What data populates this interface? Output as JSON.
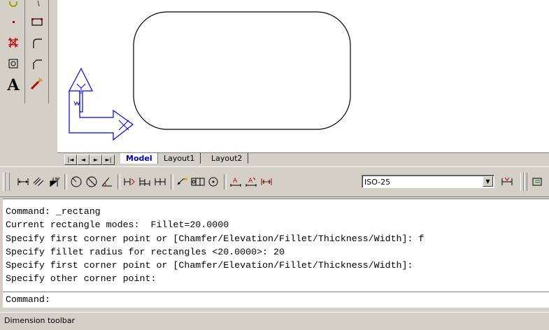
{
  "left_toolbars": {
    "col1": [
      "point-icon",
      "hatch-icon",
      "region-icon",
      "text-icon"
    ],
    "col2": [
      "rectangle-icon",
      "fillet-icon",
      "chamfer-icon",
      "explode-icon"
    ]
  },
  "layout_tabs": {
    "nav": [
      "|◄",
      "◄",
      "►",
      "►|"
    ],
    "tabs": [
      "Model",
      "Layout1",
      "Layout2"
    ],
    "active": "Model"
  },
  "dimension_toolbar": {
    "icons": [
      "linear-dim-icon",
      "aligned-dim-icon",
      "ordinate-dim-icon",
      "radius-dim-icon",
      "diameter-dim-icon",
      "angular-dim-icon",
      "quick-dim-icon",
      "baseline-dim-icon",
      "continue-dim-icon",
      "leader-icon",
      "tolerance-icon",
      "center-mark-icon",
      "dimedit-icon",
      "dimtedit-icon",
      "dimupdate-icon"
    ],
    "style_value": "ISO-25",
    "after_icons": [
      "dimstyle-icon"
    ]
  },
  "command_window": {
    "history": [
      "Command: _rectang",
      "Current rectangle modes:  Fillet=20.0000",
      "Specify first corner point or [Chamfer/Elevation/Fillet/Thickness/Width]: f",
      "Specify fillet radius for rectangles <20.0000>: 20",
      "Specify first corner point or [Chamfer/Elevation/Fillet/Thickness/Width]:",
      "Specify other corner point:"
    ],
    "prompt": "Command:"
  },
  "status_bar": {
    "text": "Dimension toolbar"
  },
  "ucs_icon": {
    "x_label": "X",
    "y_label": "Y",
    "w_label": "W"
  },
  "colors": {
    "ucs": "#0000ff",
    "background": "#d4d0c8"
  }
}
